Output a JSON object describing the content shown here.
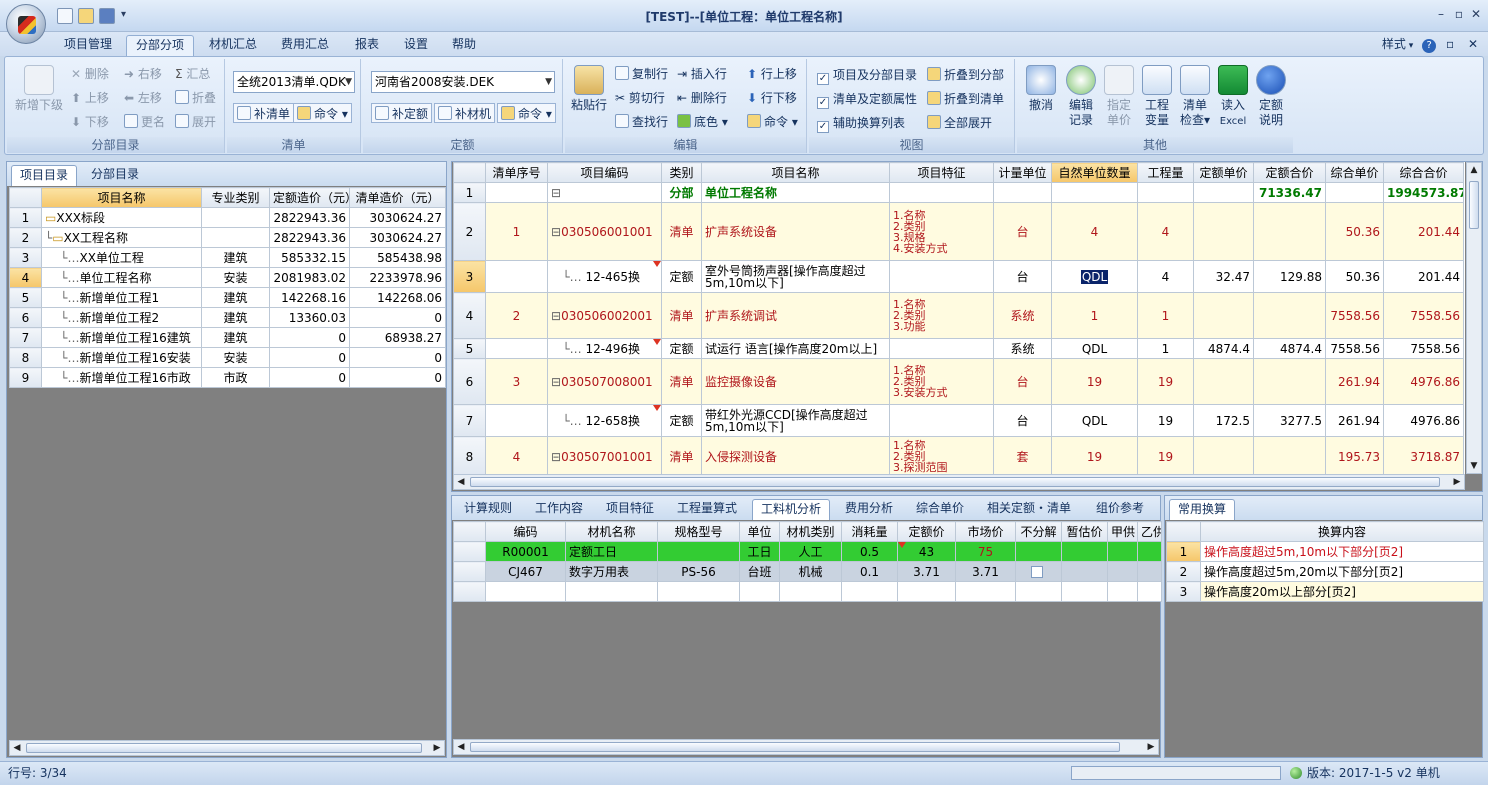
{
  "window": {
    "title": "[TEST]--[单位工程：单位工程名称]",
    "minimize": "–",
    "maximize": "▫",
    "close": "✕"
  },
  "menu": {
    "tabs": [
      "项目管理",
      "分部分项",
      "材机汇总",
      "费用汇总",
      "报表",
      "设置",
      "帮助"
    ],
    "style_label": "样式",
    "help": "?"
  },
  "ribbon": {
    "group1": {
      "name": "分部目录",
      "big": "新增下级",
      "delete": "删除",
      "moveup": "上移",
      "movedown": "下移",
      "right": "右移",
      "left": "左移",
      "rename": "更名",
      "sum": "汇总",
      "fold": "折叠",
      "expand": "展开"
    },
    "group2": {
      "name": "清单",
      "combo": "全统2013清单.QDK",
      "add": "补清单",
      "cmd": "命令"
    },
    "group3": {
      "name": "定额",
      "combo": "河南省2008安装.DEK",
      "add_quota": "补定额",
      "add_mat": "补材机",
      "cmd": "命令"
    },
    "group4": {
      "name": "编辑",
      "paste": "粘贴行",
      "copy": "复制行",
      "cut": "剪切行",
      "find": "查找行",
      "insert": "插入行",
      "delrow": "删除行",
      "color": "底色",
      "up": "行上移",
      "down": "行下移",
      "cmd": "命令"
    },
    "group5": {
      "name": "视图",
      "c1": "项目及分部目录",
      "c2": "清单及定额属性",
      "c3": "辅助换算列表",
      "f1": "折叠到分部",
      "f2": "折叠到清单",
      "f3": "全部展开"
    },
    "group6": {
      "name": "其他",
      "b1": "撤消",
      "b2a": "编辑",
      "b2b": "记录",
      "b3a": "指定",
      "b3b": "单价",
      "b4a": "工程",
      "b4b": "变量",
      "b5a": "清单",
      "b5b": "检查",
      "b6a": "读入",
      "b6b": "Excel",
      "b7a": "定额",
      "b7b": "说明"
    }
  },
  "left": {
    "tabs": [
      "项目目录",
      "分部目录"
    ],
    "headers": [
      "项目名称",
      "专业类别",
      "定额造价（元）",
      "清单造价（元）"
    ],
    "rows": [
      {
        "n": "1",
        "name": "XXX标段",
        "cat": "",
        "q": "2822943.36",
        "l": "3030624.27"
      },
      {
        "n": "2",
        "name": "XX工程名称",
        "cat": "",
        "q": "2822943.36",
        "l": "3030624.27"
      },
      {
        "n": "3",
        "name": "XX单位工程",
        "cat": "建筑",
        "q": "585332.15",
        "l": "585438.98"
      },
      {
        "n": "4",
        "name": "单位工程名称",
        "cat": "安装",
        "q": "2081983.02",
        "l": "2233978.96"
      },
      {
        "n": "5",
        "name": "新增单位工程1",
        "cat": "建筑",
        "q": "142268.16",
        "l": "142268.06"
      },
      {
        "n": "6",
        "name": "新增单位工程2",
        "cat": "建筑",
        "q": "13360.03",
        "l": "0"
      },
      {
        "n": "7",
        "name": "新增单位工程16建筑",
        "cat": "建筑",
        "q": "0",
        "l": "68938.27"
      },
      {
        "n": "8",
        "name": "新增单位工程16安装",
        "cat": "安装",
        "q": "0",
        "l": "0"
      },
      {
        "n": "9",
        "name": "新增单位工程16市政",
        "cat": "市政",
        "q": "0",
        "l": "0"
      }
    ]
  },
  "main": {
    "headers": [
      "清单序号",
      "项目编码",
      "类别",
      "项目名称",
      "项目特征",
      "计量单位",
      "自然单位数量",
      "工程量",
      "定额单价",
      "定额合价",
      "综合单价",
      "综合合价"
    ],
    "rows": [
      {
        "n": "1",
        "seq": "",
        "code": "",
        "type": "分部",
        "name": "单位工程名称",
        "feat": "",
        "unit": "",
        "nat": "",
        "qty": "",
        "qp": "",
        "qt": "71336.47",
        "up": "",
        "ut": "1994573.87"
      },
      {
        "n": "2",
        "seq": "1",
        "code": "030506001001",
        "type": "清单",
        "name": "扩声系统设备",
        "feat": "1.名称\n2.类别\n3.规格\n4.安装方式",
        "unit": "台",
        "nat": "4",
        "qty": "4",
        "qp": "",
        "qt": "",
        "up": "50.36",
        "ut": "201.44"
      },
      {
        "n": "3",
        "seq": "",
        "code": "12-465换",
        "type": "定额",
        "name": "室外号筒扬声器[操作高度超过\n5m,10m以下]",
        "feat": "",
        "unit": "台",
        "nat": "QDL",
        "qty": "4",
        "qp": "32.47",
        "qt": "129.88",
        "up": "50.36",
        "ut": "201.44"
      },
      {
        "n": "4",
        "seq": "2",
        "code": "030506002001",
        "type": "清单",
        "name": "扩声系统调试",
        "feat": "1.名称\n2.类别\n3.功能",
        "unit": "系统",
        "nat": "1",
        "qty": "1",
        "qp": "",
        "qt": "",
        "up": "7558.56",
        "ut": "7558.56"
      },
      {
        "n": "5",
        "seq": "",
        "code": "12-496换",
        "type": "定额",
        "name": "试运行  语言[操作高度20m以上]",
        "feat": "",
        "unit": "系统",
        "nat": "QDL",
        "qty": "1",
        "qp": "4874.4",
        "qt": "4874.4",
        "up": "7558.56",
        "ut": "7558.56"
      },
      {
        "n": "6",
        "seq": "3",
        "code": "030507008001",
        "type": "清单",
        "name": "监控摄像设备",
        "feat": "1.名称\n2.类别\n3.安装方式",
        "unit": "台",
        "nat": "19",
        "qty": "19",
        "qp": "",
        "qt": "",
        "up": "261.94",
        "ut": "4976.86"
      },
      {
        "n": "7",
        "seq": "",
        "code": "12-658换",
        "type": "定额",
        "name": "带红外光源CCD[操作高度超过\n5m,10m以下]",
        "feat": "",
        "unit": "台",
        "nat": "QDL",
        "qty": "19",
        "qp": "172.5",
        "qt": "3277.5",
        "up": "261.94",
        "ut": "4976.86"
      },
      {
        "n": "8",
        "seq": "4",
        "code": "030507001001",
        "type": "清单",
        "name": "入侵探测设备",
        "feat": "1.名称\n2.类别\n3.探测范围",
        "unit": "套",
        "nat": "19",
        "qty": "19",
        "qp": "",
        "qt": "",
        "up": "195.73",
        "ut": "3718.87"
      }
    ]
  },
  "bottom": {
    "tabs": [
      "计算规则",
      "工作内容",
      "项目特征",
      "工程量算式",
      "工料机分析",
      "费用分析",
      "综合单价",
      "相关定额・清单",
      "组价参考"
    ],
    "headers": [
      "编码",
      "材机名称",
      "规格型号",
      "单位",
      "材机类别",
      "消耗量",
      "定额价",
      "市场价",
      "不分解",
      "暂估价",
      "甲供",
      "乙供"
    ],
    "rows": [
      {
        "code": "R00001",
        "name": "定额工日",
        "spec": "",
        "unit": "工日",
        "cat": "人工",
        "use": "0.5",
        "qp": "43",
        "mp": "75"
      },
      {
        "code": "CJ467",
        "name": "数字万用表",
        "spec": "PS-56",
        "unit": "台班",
        "cat": "机械",
        "use": "0.1",
        "qp": "3.71",
        "mp": "3.71"
      }
    ]
  },
  "conv": {
    "tab": "常用换算",
    "header": "换算内容",
    "rows": [
      {
        "n": "1",
        "t": "操作高度超过5m,10m以下部分[页2]"
      },
      {
        "n": "2",
        "t": "操作高度超过5m,20m以下部分[页2]"
      },
      {
        "n": "3",
        "t": "操作高度20m以上部分[页2]"
      }
    ]
  },
  "status": {
    "row": "行号:  3/34",
    "version": "版本: 2017-1-5 v2 单机"
  }
}
